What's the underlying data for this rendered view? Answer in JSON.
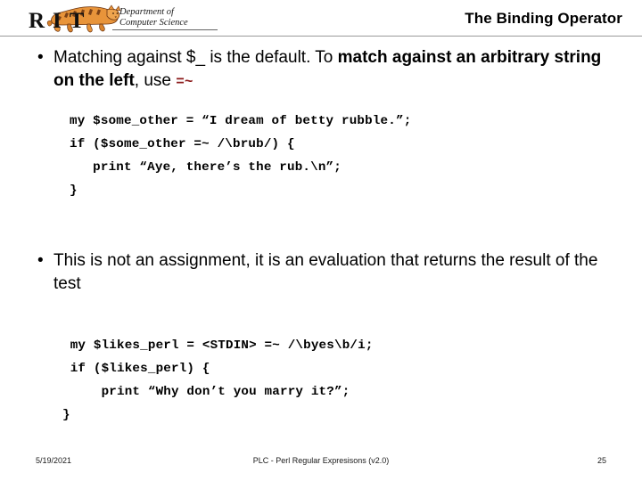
{
  "header": {
    "logo": {
      "institution": "RIT",
      "department_line1": "Department of",
      "department_line2": "Computer Science",
      "mascot": "tiger-mascot"
    },
    "title": "The Binding Operator"
  },
  "content": {
    "bullet_marker": "•",
    "bullets": [
      {
        "id": "bullet-binding-default",
        "segments": [
          {
            "text": "Matching against $_ is the default.  To ",
            "style": "normal"
          },
          {
            "text": "match against an arbitrary string on the left",
            "style": "bold"
          },
          {
            "text": ", use ",
            "style": "normal"
          },
          {
            "text": "=~",
            "style": "operator"
          }
        ]
      },
      {
        "id": "bullet-evaluation-not-assignment",
        "segments": [
          {
            "text": "This is not an assignment, it is an evaluation that returns the result of the test",
            "style": "normal"
          }
        ]
      }
    ],
    "code_blocks": [
      {
        "id": "code-some-other",
        "lines": [
          "my $some_other = “I dream of betty rubble.”;",
          "if ($some_other =~ /\\brub/) {",
          "   print “Aye, there’s the rub.\\n”;",
          "}"
        ]
      },
      {
        "id": "code-likes-perl",
        "lines": [
          " my $likes_perl = <STDIN> =~ /\\byes\\b/i;",
          " if ($likes_perl) {",
          "     print “Why don’t you marry it?”;",
          "}"
        ]
      }
    ]
  },
  "footer": {
    "date": "5/19/2021",
    "subject": "PLC - Perl Regular Expresisons  (v2.0)",
    "page_number": "25"
  },
  "colors": {
    "operator_red": "#8B1A1A",
    "rule_gray": "#9a9a9a",
    "text_black": "#000000"
  }
}
